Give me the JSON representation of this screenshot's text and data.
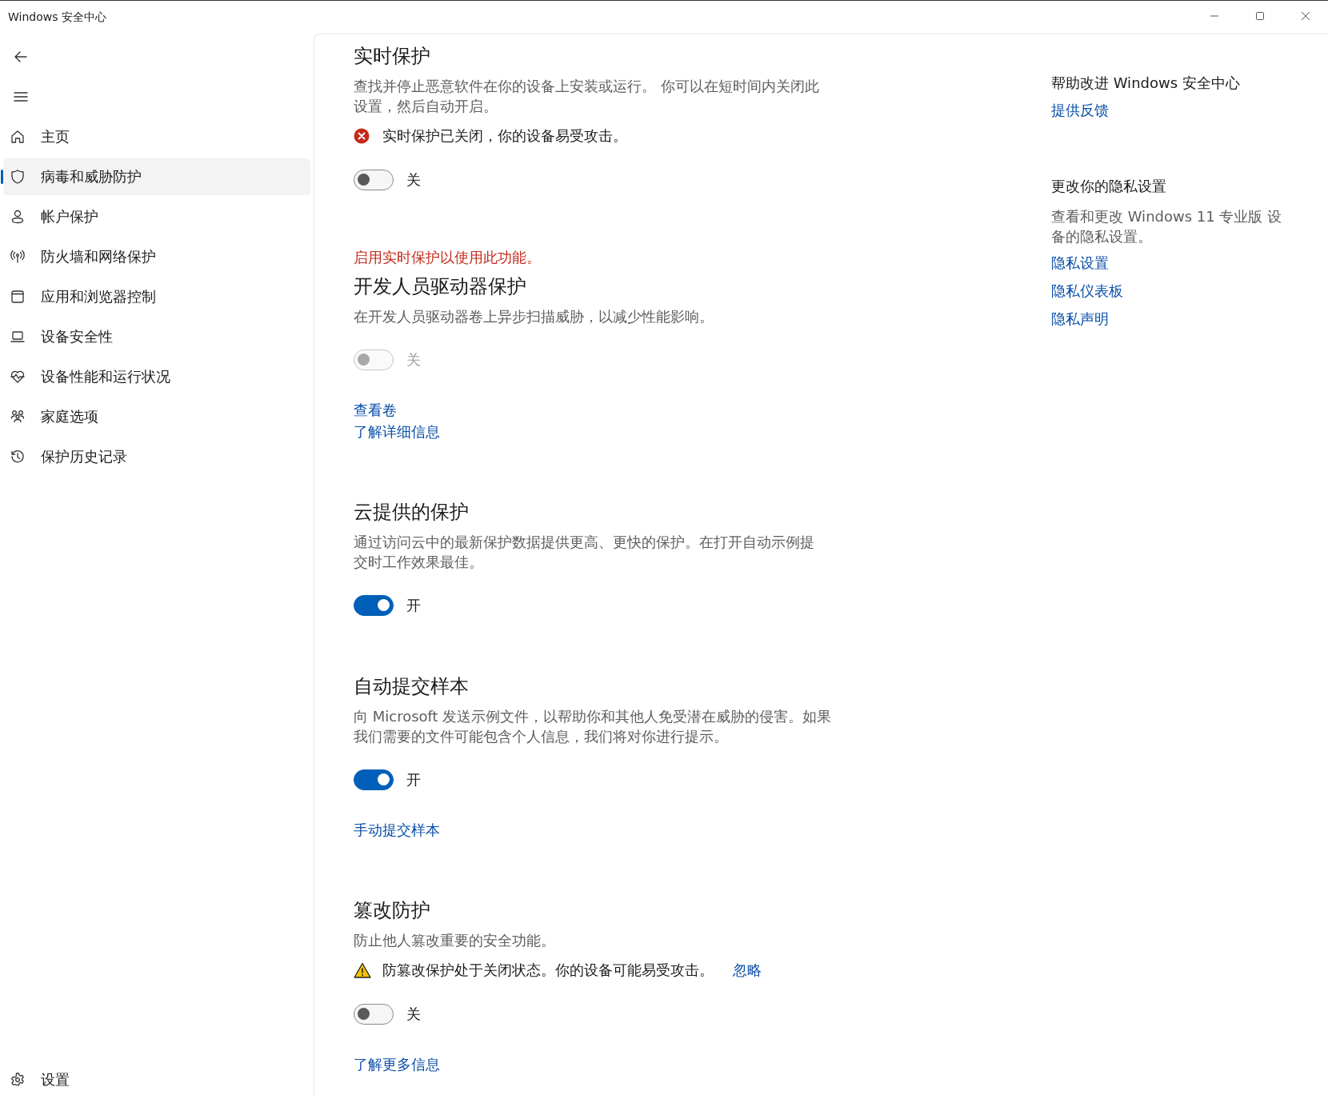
{
  "window": {
    "title": "Windows 安全中心"
  },
  "sidebar": {
    "items": [
      {
        "label": "主页",
        "selected": false
      },
      {
        "label": "病毒和威胁防护",
        "selected": true
      },
      {
        "label": "帐户保护",
        "selected": false
      },
      {
        "label": "防火墙和网络保护",
        "selected": false
      },
      {
        "label": "应用和浏览器控制",
        "selected": false
      },
      {
        "label": "设备安全性",
        "selected": false
      },
      {
        "label": "设备性能和运行状况",
        "selected": false
      },
      {
        "label": "家庭选项",
        "selected": false
      },
      {
        "label": "保护历史记录",
        "selected": false
      }
    ],
    "footer": {
      "label": "设置"
    }
  },
  "sections": [
    {
      "title": "实时保护",
      "description": "查找并停止恶意软件在你的设备上安装或运行。 你可以在短时间内关闭此设置，然后自动开启。",
      "notice": {
        "kind": "error",
        "text": "实时保护已关闭，你的设备易受攻击。"
      },
      "toggle": {
        "on": false,
        "disabled": false,
        "label": "关"
      }
    },
    {
      "requirement": "启用实时保护以使用此功能。",
      "title": "开发人员驱动器保护",
      "description": "在开发人员驱动器卷上异步扫描威胁，以减少性能影响。",
      "toggle": {
        "on": false,
        "disabled": true,
        "label": "关"
      },
      "links": [
        "查看卷",
        "了解详细信息"
      ]
    },
    {
      "title": "云提供的保护",
      "description": "通过访问云中的最新保护数据提供更高、更快的保护。在打开自动示例提交时工作效果最佳。",
      "toggle": {
        "on": true,
        "disabled": false,
        "label": "开"
      }
    },
    {
      "title": "自动提交样本",
      "description": "向 Microsoft 发送示例文件，以帮助你和其他人免受潜在威胁的侵害。如果我们需要的文件可能包含个人信息，我们将对你进行提示。",
      "toggle": {
        "on": true,
        "disabled": false,
        "label": "开"
      },
      "links": [
        "手动提交样本"
      ]
    },
    {
      "title": "篡改防护",
      "description": "防止他人篡改重要的安全功能。",
      "notice": {
        "kind": "warning",
        "text": "防篡改保护处于关闭状态。你的设备可能易受攻击。",
        "link": "忽略"
      },
      "toggle": {
        "on": false,
        "disabled": false,
        "label": "关"
      },
      "links": [
        "了解更多信息"
      ]
    }
  ],
  "aside": [
    {
      "title": "帮助改进 Windows 安全中心",
      "links": [
        "提供反馈"
      ]
    },
    {
      "title": "更改你的隐私设置",
      "description": "查看和更改 Windows 11 专业版 设备的隐私设置。",
      "links": [
        "隐私设置",
        "隐私仪表板",
        "隐私声明"
      ]
    }
  ]
}
